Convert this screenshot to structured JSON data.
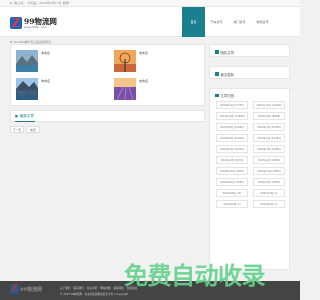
{
  "topbar": {
    "home_icon": "home-icon",
    "text": "晚上好！ 今天是：2024年2月15日 星期一"
  },
  "header": {
    "logo_letter": "Z",
    "logo_name": "99物流网",
    "logo_sub": "www.99wl.com"
  },
  "nav": [
    {
      "label": "首页",
      "active": true
    },
    {
      "label": "汽车资讯",
      "active": false
    },
    {
      "label": "热门资讯",
      "active": false
    },
    {
      "label": "物流资讯",
      "active": false
    }
  ],
  "breadcrumb": {
    "icon": "home-icon",
    "text": "Tell 8bl威尔克兰品运输知识"
  },
  "posts": [
    {
      "title": "未命名",
      "meta": "",
      "thumb": "lake-mountains"
    },
    {
      "title": "未命名",
      "meta": "",
      "thumb": "autumn-tree"
    },
    {
      "title": "未命名",
      "meta": "",
      "thumb": "mountain-reflection"
    },
    {
      "title": "未命名",
      "meta": "",
      "thumb": "lavender-field"
    }
  ],
  "latest": {
    "icon": "doc-icon",
    "title": "最新文章"
  },
  "pager": {
    "prev": "下一页",
    "next": "末页"
  },
  "sidebar": {
    "hot": "随机文章",
    "recent": "最近更新",
    "archive_title": "文章归档",
    "archive": [
      "2023年12月 (5745)",
      "2023年11月 (11400)",
      "2023年10月 (13894)",
      "2023年9月 (5658)",
      "2023年8月 (12030)",
      "2023年7月 (12550)",
      "2023年6月 (10910)",
      "2023年5月 (22784)",
      "2023年4月 (39700)",
      "2023年3月 (13900)",
      "2023年2月 (3279)",
      "2023年1月 (1960)",
      "2022年12月 (1900)",
      "2022年11月 (3050)",
      "2022年10月 (3280)",
      "2022年9月 (1865)",
      "2022年8月 (19)",
      "2022年7月 (1)",
      "2022年6月 (1)",
      "2022年5月 (1)"
    ]
  },
  "footer": {
    "logo": "99物流网",
    "links": [
      "关于我们",
      "联系我们",
      "免责声明",
      "网站地图",
      "投稿须知",
      "友情链接"
    ],
    "copy": "© 2023 99物流网 - 专业的货运物流信息平台 | Copyright"
  },
  "watermark": "免费自动收录"
}
